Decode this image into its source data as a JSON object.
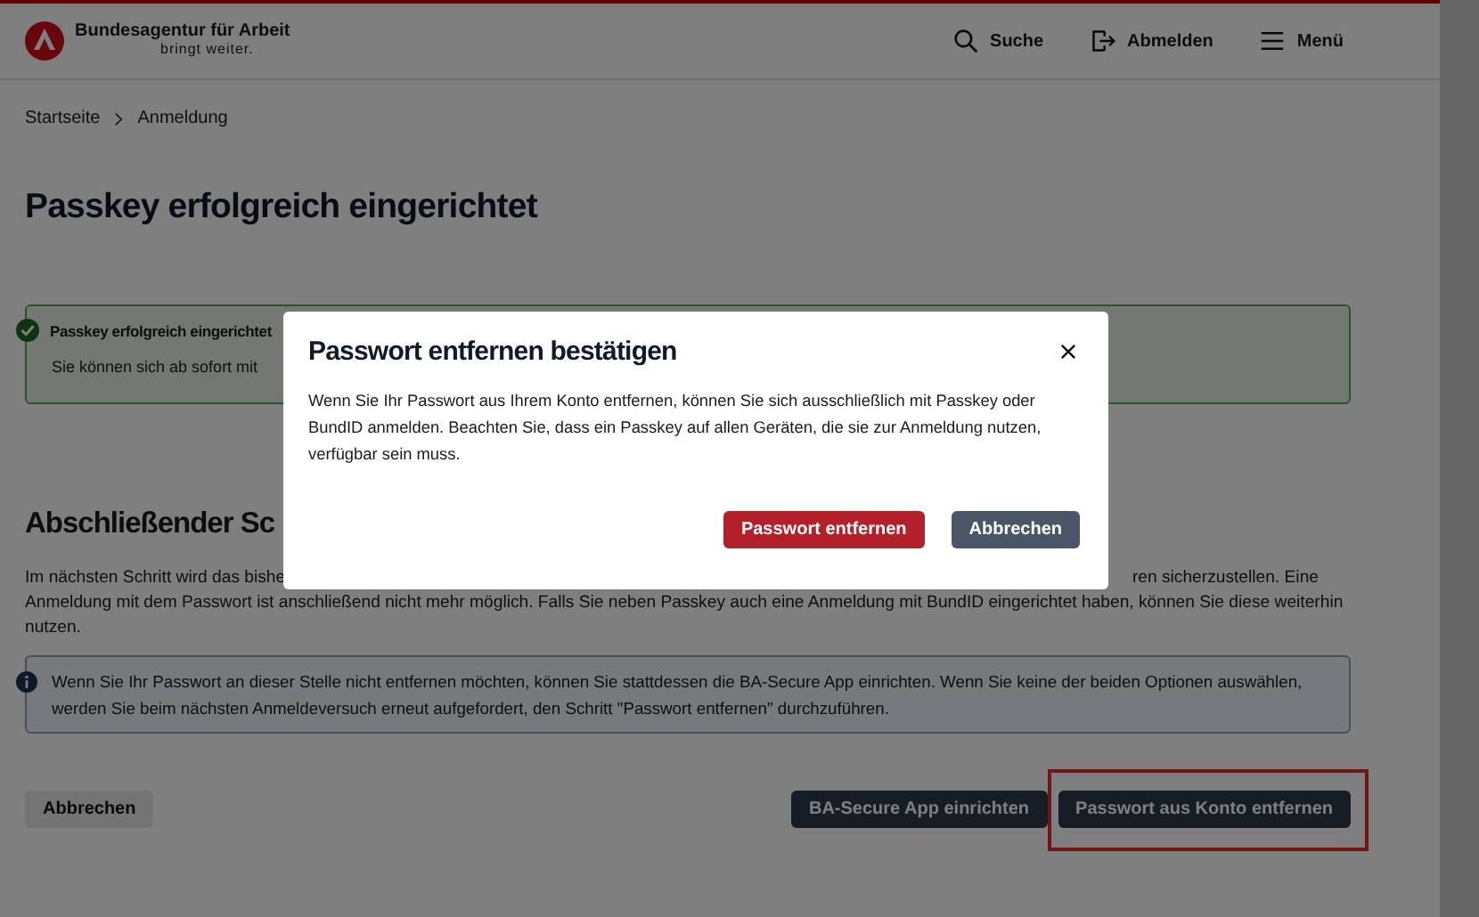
{
  "header": {
    "logo_name": "Bundesagentur für Arbeit",
    "logo_tagline": "bringt weiter.",
    "nav": [
      {
        "label": "Suche",
        "kind": "search"
      },
      {
        "label": "Abmelden",
        "kind": "logout"
      },
      {
        "label": "Menü",
        "kind": "menu"
      }
    ]
  },
  "breadcrumb": [
    "Startseite",
    "Anmeldung"
  ],
  "page_title": "Passkey erfolgreich eingerichtet",
  "success_alert": {
    "title": "Passkey erfolgreich eingerichtet",
    "text": "Sie können sich ab sofort mit"
  },
  "section": {
    "heading": "Abschließender Sc",
    "line_1_start": "Im nächsten Schritt wird das bishe",
    "line_1_end": "ren sicherzustellen. Eine",
    "line_2": "Anmeldung mit dem Passwort ist anschließend nicht mehr möglich. Falls Sie neben Passkey auch eine Anmeldung mit BundID eingerichtet haben, können Sie diese weiterhin",
    "line_3": "nutzen."
  },
  "info_alert": {
    "text": "Wenn Sie Ihr Passwort an dieser Stelle nicht entfernen möchten, können Sie stattdessen die BA-Secure App einrichten. Wenn Sie keine der beiden Optionen auswählen, werden Sie beim nächsten Anmeldeversuch erneut aufgefordert, den Schritt \"Passwort entfernen\" durchzuführen."
  },
  "actions": {
    "cancel": "Abbrechen",
    "secondary": "BA-Secure App einrichten",
    "primary": "Passwort aus Konto entfernen",
    "highlighted": true
  },
  "dialog": {
    "title": "Passwort entfernen bestätigen",
    "text": "Wenn Sie Ihr Passwort aus Ihrem Konto entfernen, können Sie sich ausschließlich mit Passkey oder BundID anmelden. Beachten Sie, dass ein Passkey auf allen Geräten, die sie zur Anmeldung nutzen, verfügbar sein muss.",
    "buttons": [
      {
        "label": "Passwort entfernen",
        "kind": "danger"
      },
      {
        "label": "Abbrechen",
        "kind": "secondary"
      }
    ]
  }
}
